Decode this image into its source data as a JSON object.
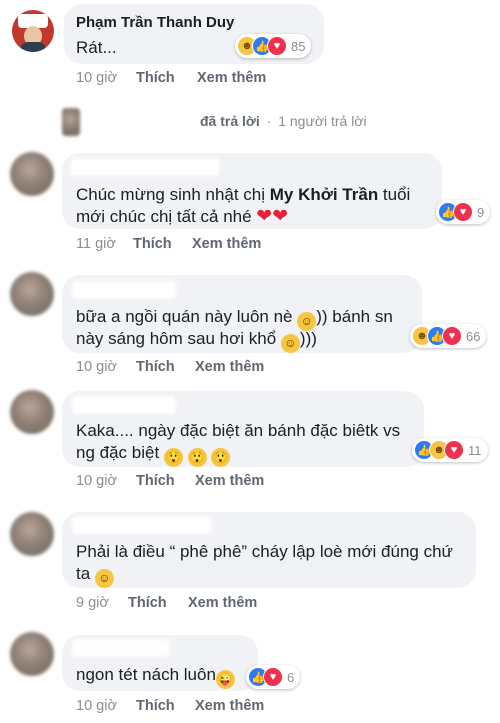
{
  "comment1": {
    "author": "Phạm Trần Thanh Duy",
    "text": "Rát...",
    "reaction_count": "85",
    "time": "10 giờ",
    "like": "Thích",
    "more": "Xem thêm"
  },
  "replies_bar": {
    "replied": "đã trả lời",
    "separator": "·",
    "count": "1 người trả lời"
  },
  "comment2": {
    "text_pre": "Chúc mừng sinh nhật chị ",
    "mention": "My Khởi Trần",
    "text_post": " tuổi",
    "text_line2": "mới chúc chị tất cả nhé",
    "reaction_count": "9",
    "time": "11 giờ",
    "like": "Thích",
    "more": "Xem thêm"
  },
  "comment3": {
    "line1": "bữa a ngồi quán này luôn nè",
    "line1b": ")) bánh sn",
    "line2": "này sáng hôm sau hơi khổ",
    "line2b": ")))",
    "reaction_count": "66",
    "time": "10 giờ",
    "like": "Thích",
    "more": "Xem thêm"
  },
  "comment4": {
    "line1": "Kaka.... ngày đặc biệt ăn bánh đặc biêtk vs",
    "line2": "ng đặc biệt",
    "reaction_count": "11",
    "time": "10 giờ",
    "like": "Thích",
    "more": "Xem thêm"
  },
  "comment5": {
    "line1": "Phải là điều “ phê phê” cháy lập loè mới đúng chứ",
    "line2": "ta",
    "time": "9 giờ",
    "like": "Thích",
    "more": "Xem thêm"
  },
  "comment6": {
    "text": "ngon tét nách luôn",
    "reaction_count": "6",
    "time": "10 giờ",
    "like": "Thích",
    "more": "Xem thêm"
  },
  "colors": {
    "bubble": "#f0f2f5",
    "like_blue": "#2d7bf4",
    "love_red": "#f0304f",
    "meta_gray": "#8a8d91"
  }
}
